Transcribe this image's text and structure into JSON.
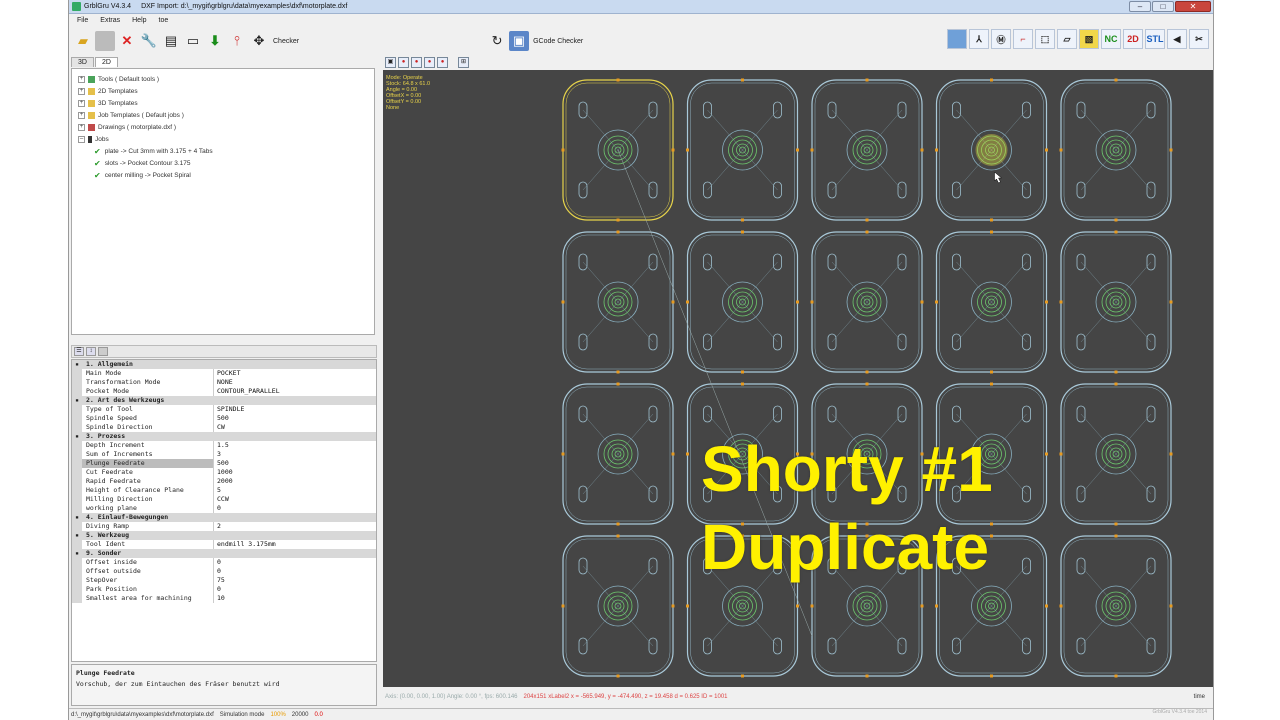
{
  "window": {
    "title": "GrblGru V4.3.4",
    "subtitle": "DXF Import: d:\\_mygit\\grblgru\\data\\myexamples\\dxf\\motorplate.dxf"
  },
  "menu": [
    "File",
    "Extras",
    "Help",
    "toe"
  ],
  "toolbar": {
    "checker_label": "Checker",
    "gcode_checker_label": "GCode Checker",
    "right_buttons": [
      "NC",
      "2D",
      "STL"
    ]
  },
  "tabs": [
    "3D",
    "2D"
  ],
  "tree": {
    "items": [
      {
        "label": "Tools  ( Default tools )"
      },
      {
        "label": "2D Templates"
      },
      {
        "label": "3D Templates"
      },
      {
        "label": "Job Templates  ( Default jobs )"
      },
      {
        "label": "Drawings  ( motorplate.dxf )"
      },
      {
        "label": "Jobs"
      }
    ],
    "jobs": [
      {
        "label": "plate  -> Cut  3mm with 3.175 + 4 Tabs"
      },
      {
        "label": "slots  -> Pocket Contour 3.175"
      },
      {
        "label": "center milling  -> Pocket Spiral"
      }
    ]
  },
  "properties": [
    {
      "cat": "1. Allgemein"
    },
    {
      "k": "Main Mode",
      "v": "POCKET"
    },
    {
      "k": "Transformation Mode",
      "v": "NONE"
    },
    {
      "k": "Pocket Mode",
      "v": "CONTOUR_PARALLEL"
    },
    {
      "cat": "2. Art des Werkzeugs"
    },
    {
      "k": "Type of Tool",
      "v": "SPINDLE"
    },
    {
      "k": "Spindle Speed",
      "v": "500"
    },
    {
      "k": "Spindle Direction",
      "v": "CW"
    },
    {
      "cat": "3. Prozess"
    },
    {
      "k": "Depth Increment",
      "v": "1.5"
    },
    {
      "k": "Sum of Increments",
      "v": "3"
    },
    {
      "k": "Plunge Feedrate",
      "v": "500",
      "sel": true
    },
    {
      "k": "Cut Feedrate",
      "v": "1000"
    },
    {
      "k": "Rapid Feedrate",
      "v": "2000"
    },
    {
      "k": "Height of Clearance Plane",
      "v": "5"
    },
    {
      "k": "Milling Direction",
      "v": "CCW"
    },
    {
      "k": "working plane",
      "v": "0"
    },
    {
      "cat": "4. Einlauf-Bewegungen"
    },
    {
      "k": "Diving Ramp",
      "v": "2"
    },
    {
      "cat": "5. Werkzeug"
    },
    {
      "k": "Tool Ident",
      "v": "endmill 3.175mm"
    },
    {
      "cat": "9. Sonder"
    },
    {
      "k": "Offset inside",
      "v": "0"
    },
    {
      "k": "Offset outside",
      "v": "0"
    },
    {
      "k": "StepOver",
      "v": "75"
    },
    {
      "k": "Park Position",
      "v": "0"
    },
    {
      "k": "Smallest area for machining",
      "v": "10"
    }
  ],
  "description": {
    "title": "Plunge Feedrate",
    "text": "Vorschub, der zum Eintauchen des Fräser benutzt wird"
  },
  "canvas_info": [
    "Mode: Operate",
    "Stock: 64.8 x 61.0",
    "Angle = 0.00",
    "OffsetX = 0.00",
    "OffsetY = 0.00",
    "None"
  ],
  "overlay": {
    "line1": "Shorty #1",
    "line2": "Duplicate"
  },
  "status_line": {
    "axis": "Axis: (0.00, 0.00, 1.00)  Angle: 0.00 °,  fps: 600.146",
    "rest": "204x151  xLabel2  x = -565.949,  y = -474.490,  z = 19.458   d = 0.625   ID = 1001"
  },
  "time_label": "time",
  "statusbar": {
    "path": "d:\\_mygit\\grblgru\\data\\myexamples\\dxf\\motorplate.dxf",
    "mode": "Simulation mode",
    "pct": "100%",
    "num": "20000",
    "red": "0.0",
    "version": "GrblGru V4.3.4 toe 2014"
  },
  "colors": {
    "canvas_bg": "#454545",
    "plate_outline": "#a9c9d9",
    "highlight": "#e6d34a",
    "overlay_text": "#fff100"
  }
}
